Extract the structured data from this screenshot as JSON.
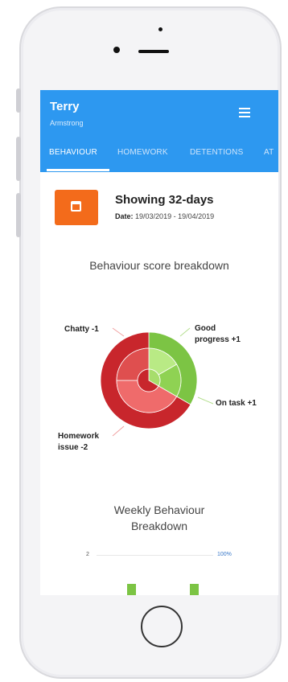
{
  "user": {
    "first_name": "Terry",
    "last_name": "Armstrong"
  },
  "tabs": [
    {
      "label": "BEHAVIOUR",
      "active": true
    },
    {
      "label": "HOMEWORK",
      "active": false
    },
    {
      "label": "DETENTIONS",
      "active": false
    },
    {
      "label": "AT",
      "active": false
    }
  ],
  "period": {
    "showing": "Showing 32-days",
    "date_label": "Date:",
    "date_range": "19/03/2019 - 19/04/2019"
  },
  "breakdown": {
    "title": "Behaviour score breakdown",
    "labels": [
      "Chatty -1",
      "Good progress +1",
      "On task +1",
      "Homework issue -2"
    ],
    "colors": {
      "negative": "#c8262c",
      "positive": "#7cc444"
    }
  },
  "weekly": {
    "title": "Weekly Behaviour Breakdown",
    "axis_min": "2",
    "axis_max": "100%"
  },
  "colors": {
    "app_bar": "#2d98f0",
    "calendar_button": "#f36b1b"
  },
  "icons": [
    "menu-icon",
    "calendar-icon",
    "camera-icon",
    "speaker-icon",
    "home-button-icon"
  ]
}
